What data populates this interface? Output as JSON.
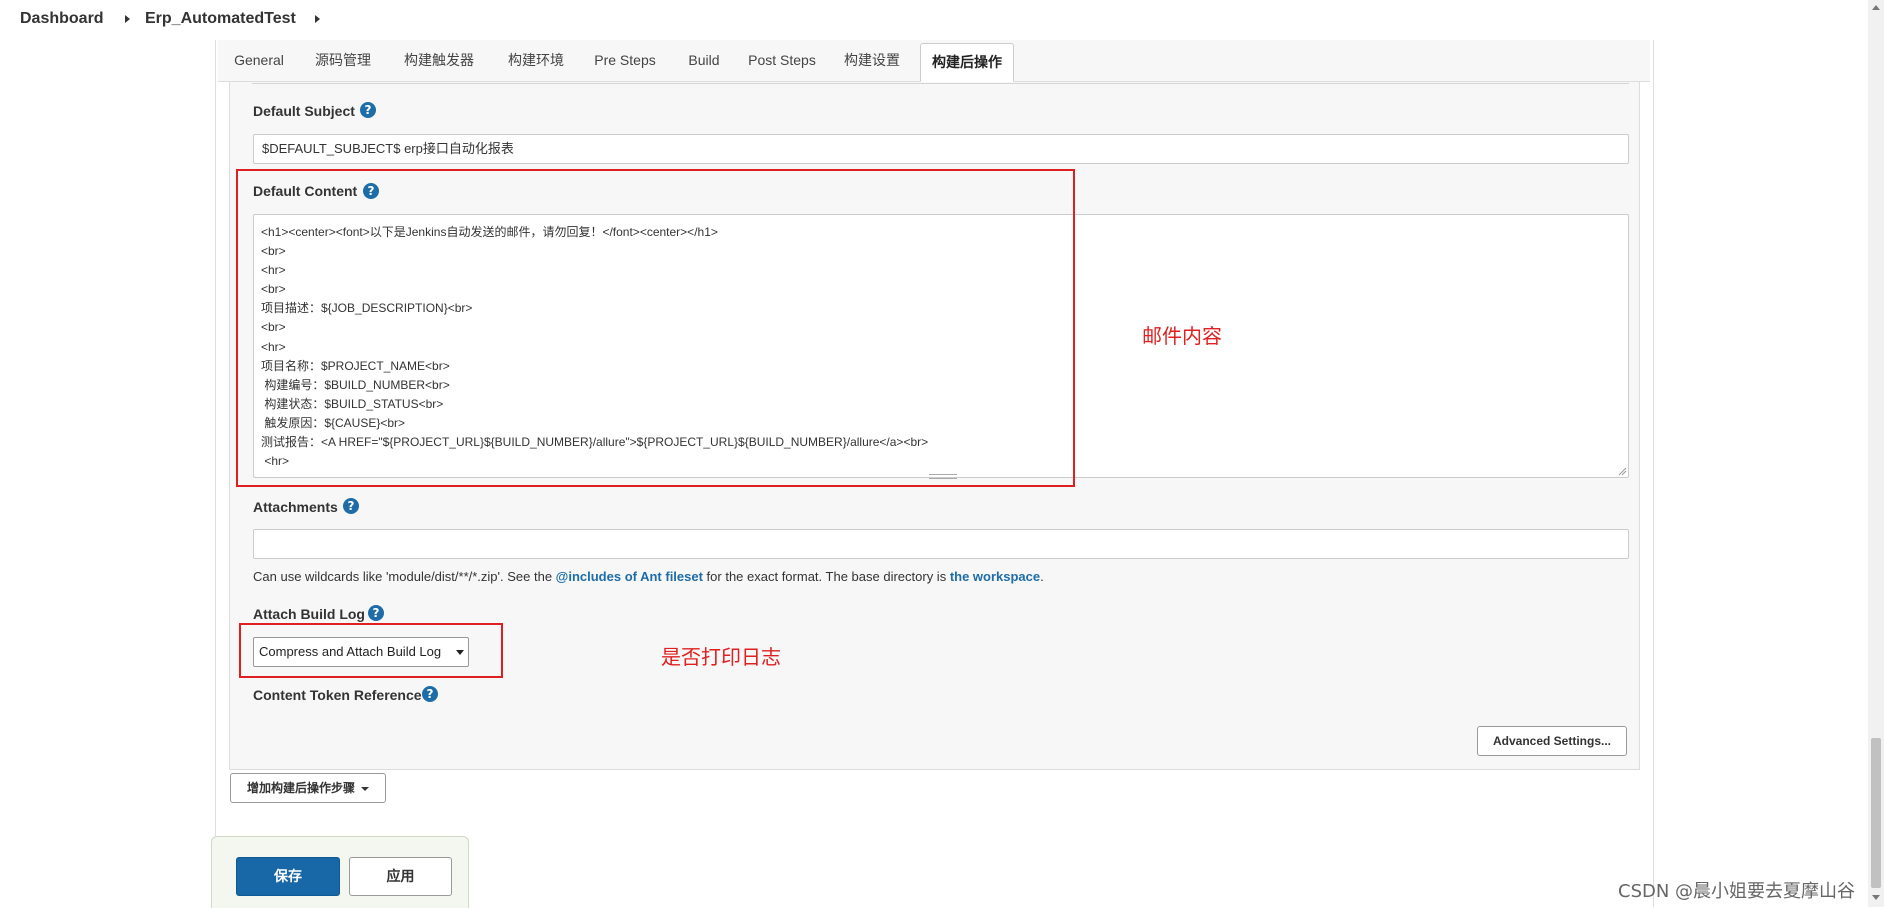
{
  "breadcrumb": {
    "items": [
      "Dashboard",
      "Erp_AutomatedTest"
    ]
  },
  "tabs": [
    {
      "label": "General"
    },
    {
      "label": "源码管理"
    },
    {
      "label": "构建触发器"
    },
    {
      "label": "构建环境"
    },
    {
      "label": "Pre Steps"
    },
    {
      "label": "Build"
    },
    {
      "label": "Post Steps"
    },
    {
      "label": "构建设置"
    },
    {
      "label": "构建后操作",
      "active": true
    }
  ],
  "form": {
    "default_subject": {
      "label": "Default Subject",
      "value": "$DEFAULT_SUBJECT$ erp接口自动化报表"
    },
    "default_content": {
      "label": "Default Content",
      "lines": [
        "<h1><center><font>以下是Jenkins自动发送的邮件，请勿回复！</font><center></h1>",
        "<br>",
        "<hr>",
        "<br>",
        "项目描述：${JOB_DESCRIPTION}<br>",
        "<br>",
        "<hr>",
        "项目名称：$PROJECT_NAME<br>",
        " 构建编号：$BUILD_NUMBER<br>",
        " 构建状态：$BUILD_STATUS<br>",
        " 触发原因：${CAUSE}<br>",
        "测试报告：<A HREF=\"${PROJECT_URL}${BUILD_NUMBER}/allure\">${PROJECT_URL}${BUILD_NUMBER}/allure</a><br>",
        " <hr>"
      ]
    },
    "attachments": {
      "label": "Attachments",
      "value": "",
      "hint_prefix": "Can use wildcards like 'module/dist/**/*.zip'. See the ",
      "hint_link1": "@includes of Ant fileset",
      "hint_middle": " for the exact format. The base directory is ",
      "hint_link2": "the workspace",
      "hint_suffix": "."
    },
    "attach_build_log": {
      "label": "Attach Build Log",
      "selected": "Compress and Attach Build Log"
    },
    "content_token_reference": {
      "label": "Content Token Reference"
    },
    "advanced_settings_label": "Advanced Settings...",
    "add_post_build_step_label": "增加构建后操作步骤"
  },
  "footer": {
    "save_label": "保存",
    "apply_label": "应用"
  },
  "annotations": {
    "mail_content": "邮件内容",
    "print_log": "是否打印日志"
  },
  "help_icon": "?",
  "watermark": "CSDN @晨小姐要去夏摩山谷",
  "colors": {
    "accent": "#1e6da8",
    "annotation_red": "#e02020",
    "primary_button": "#1867a6"
  }
}
